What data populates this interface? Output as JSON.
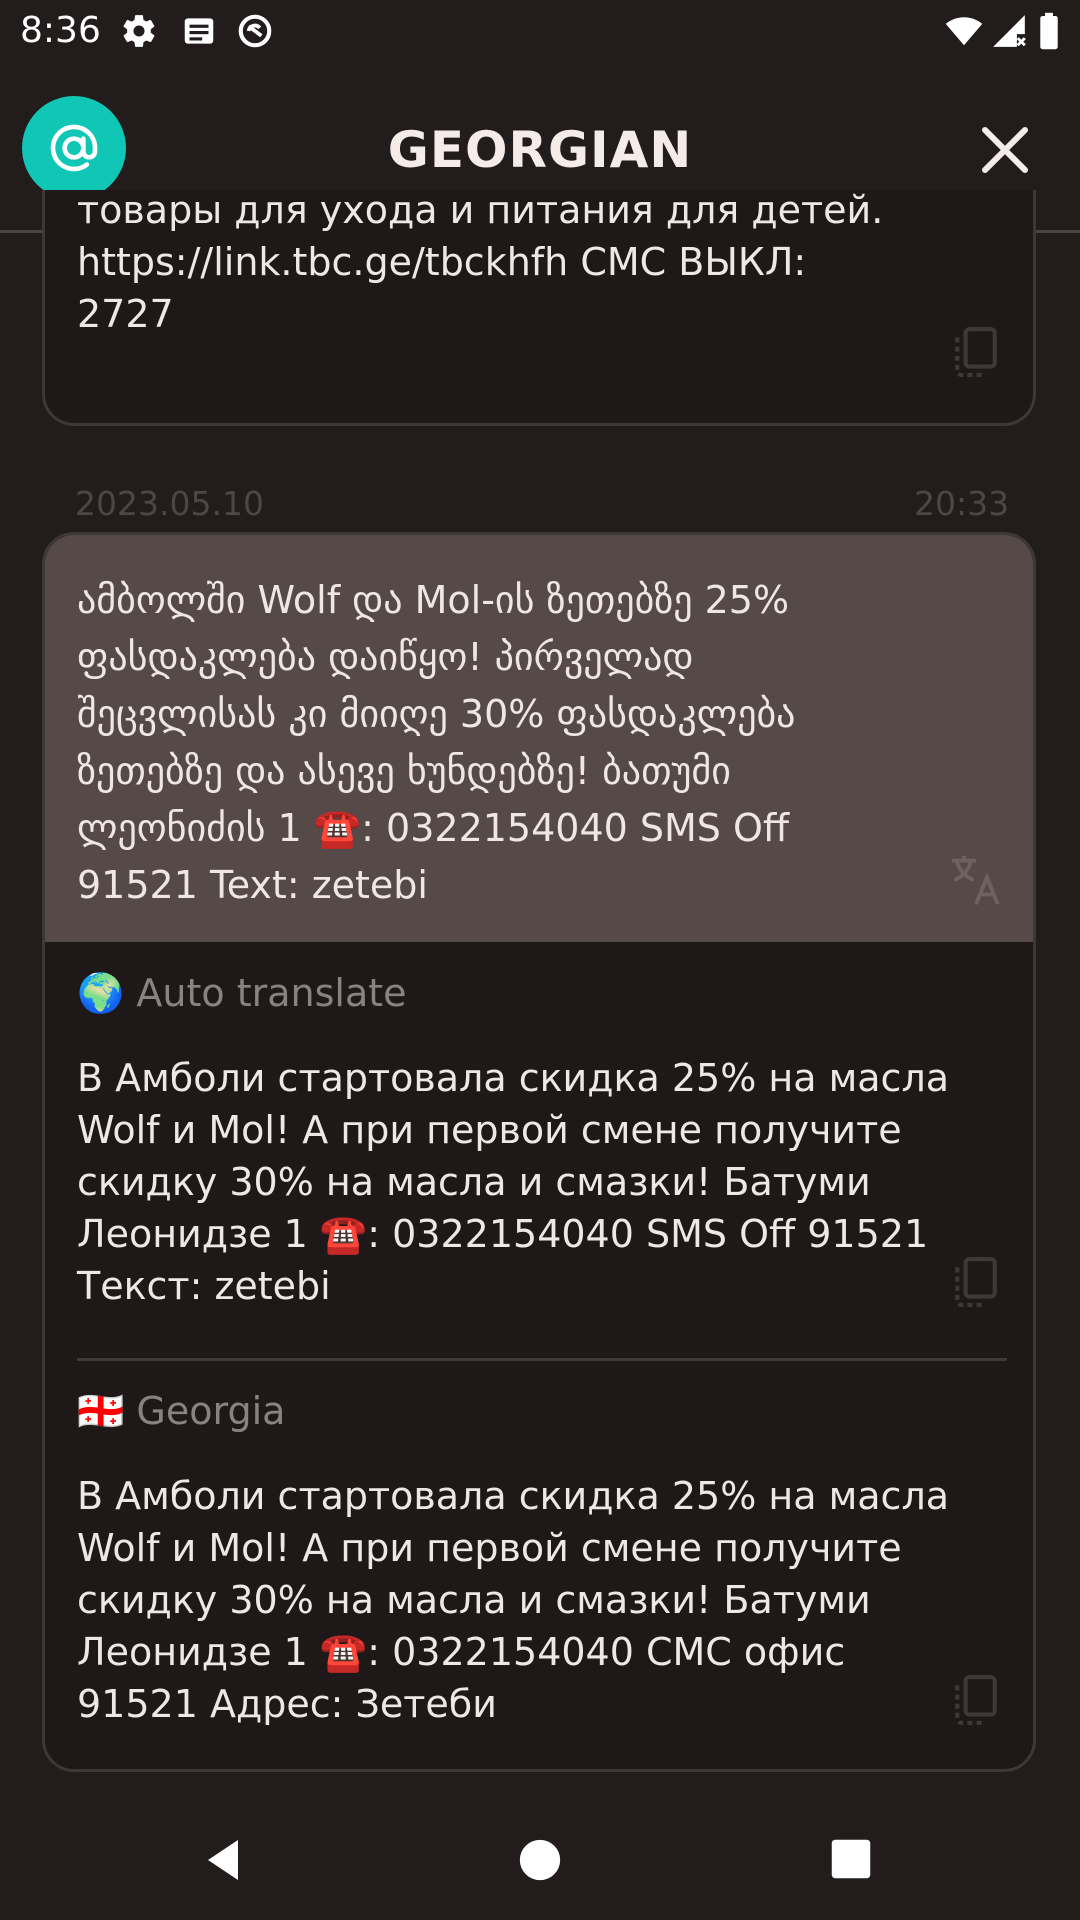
{
  "status_bar": {
    "time": "8:36",
    "icons": [
      "settings-icon",
      "notification-icon",
      "sync-icon",
      "wifi-icon",
      "signal-icon",
      "battery-icon"
    ]
  },
  "app_bar": {
    "title": "GEORGIAN",
    "logo_icon": "at-sign-icon",
    "close_icon": "close-icon",
    "accent_color": "#10c7b6"
  },
  "previous_message": {
    "text": "товары для ухода и питания для детей.\nhttps://link.tbc.ge/tbckhfh СМС ВЫКЛ:\n2727"
  },
  "message": {
    "date": "2023.05.10",
    "time": "20:33",
    "original_text": "ამბოლში Wolf და Mol-ის ზეთებზე 25%\nფასდაკლება დაიწყო! პირველად\nშეცვლისას კი მიიღე 30% ფასდაკლება\nზეთებზე და ასევე ხუნდებზე! ბათუმი\nლეონიძის 1 ☎️: 0322154040 SMS Off\n91521 Text: zetebi",
    "translations": [
      {
        "label": "Auto translate",
        "flag": "🌍",
        "text": "В Амболи стартовала скидка 25% на масла\nWolf и Mol! А при первой смене получите\nскидку 30% на масла и смазки! Батуми\nЛеонидзе 1 ☎️: 0322154040 SMS Off 91521\nТекст: zetebi"
      },
      {
        "label": "Georgia",
        "flag": "🇬🇪",
        "text": "В Амболи стартовала скидка 25% на масла\nWolf и Mol! А при первой смене получите\nскидку 30% на масла и смазки! Батуми\nЛеонидзе 1 ☎️: 0322154040 СМС офис\n91521 Адрес: Зетеби"
      }
    ]
  },
  "nav_bar": {
    "icons": [
      "back-icon",
      "home-icon",
      "recents-icon"
    ]
  }
}
